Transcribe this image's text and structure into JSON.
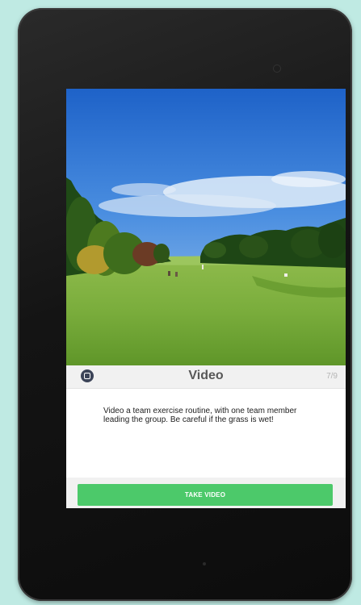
{
  "colors": {
    "background": "#bfeae3",
    "device": "#141414",
    "accent_green": "#4cc96a",
    "title_text": "#585858",
    "icon_dark": "#3c4458"
  },
  "task": {
    "title": "Video",
    "progress": "7/9",
    "description": "Video a team exercise routine, with one team member leading the group. Be careful if the grass is wet!",
    "action_label": "TAKE VIDEO",
    "back_icon": "back-icon"
  }
}
